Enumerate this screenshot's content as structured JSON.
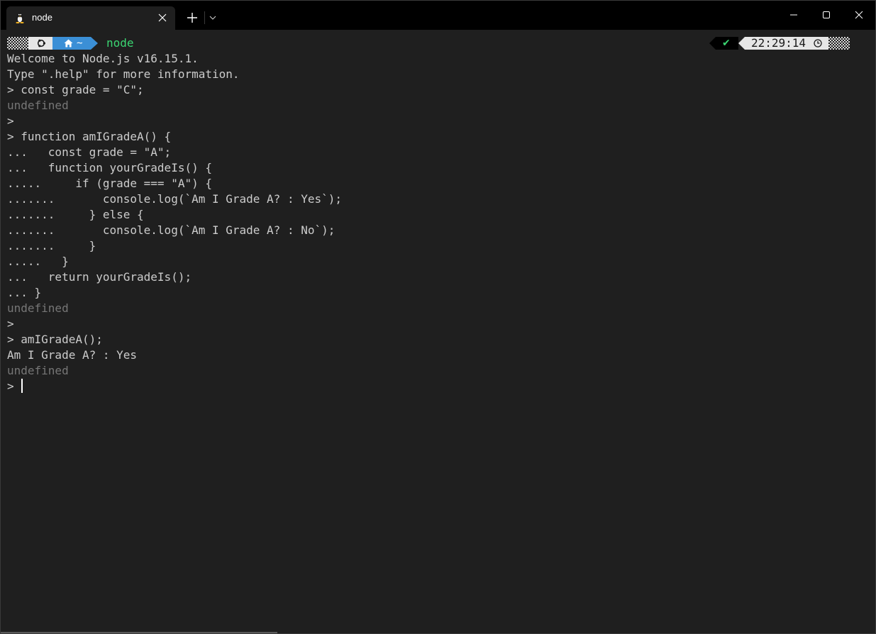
{
  "tab": {
    "title": "node",
    "icon": "linux-penguin-icon"
  },
  "titlebar": {
    "new_tab": "+",
    "controls": [
      "minimize",
      "maximize",
      "close"
    ]
  },
  "prompt": {
    "path": "~",
    "command": "node",
    "status_symbol": "✔",
    "time": "22:29:14",
    "colors": {
      "path_segment": "#3b8fd6",
      "command": "#3bd672",
      "os_segment": "#e6e6e6"
    }
  },
  "terminal_lines": [
    {
      "text": "Welcome to Node.js v16.15.1.",
      "dim": false
    },
    {
      "text": "Type \".help\" for more information.",
      "dim": false
    },
    {
      "text": "> const grade = \"C\";",
      "dim": false
    },
    {
      "text": "undefined",
      "dim": true
    },
    {
      "text": ">",
      "dim": false
    },
    {
      "text": "> function amIGradeA() {",
      "dim": false
    },
    {
      "text": "...   const grade = \"A\";",
      "dim": false
    },
    {
      "text": "...   function yourGradeIs() {",
      "dim": false
    },
    {
      "text": ".....     if (grade === \"A\") {",
      "dim": false
    },
    {
      "text": ".......       console.log(`Am I Grade A? : Yes`);",
      "dim": false
    },
    {
      "text": ".......     } else {",
      "dim": false
    },
    {
      "text": ".......       console.log(`Am I Grade A? : No`);",
      "dim": false
    },
    {
      "text": ".......     }",
      "dim": false
    },
    {
      "text": ".....   }",
      "dim": false
    },
    {
      "text": "...   return yourGradeIs();",
      "dim": false
    },
    {
      "text": "... }",
      "dim": false
    },
    {
      "text": "undefined",
      "dim": true
    },
    {
      "text": ">",
      "dim": false
    },
    {
      "text": "> amIGradeA();",
      "dim": false
    },
    {
      "text": "Am I Grade A? : Yes",
      "dim": false
    },
    {
      "text": "undefined",
      "dim": true
    }
  ],
  "input_line": {
    "prompt": "> "
  }
}
